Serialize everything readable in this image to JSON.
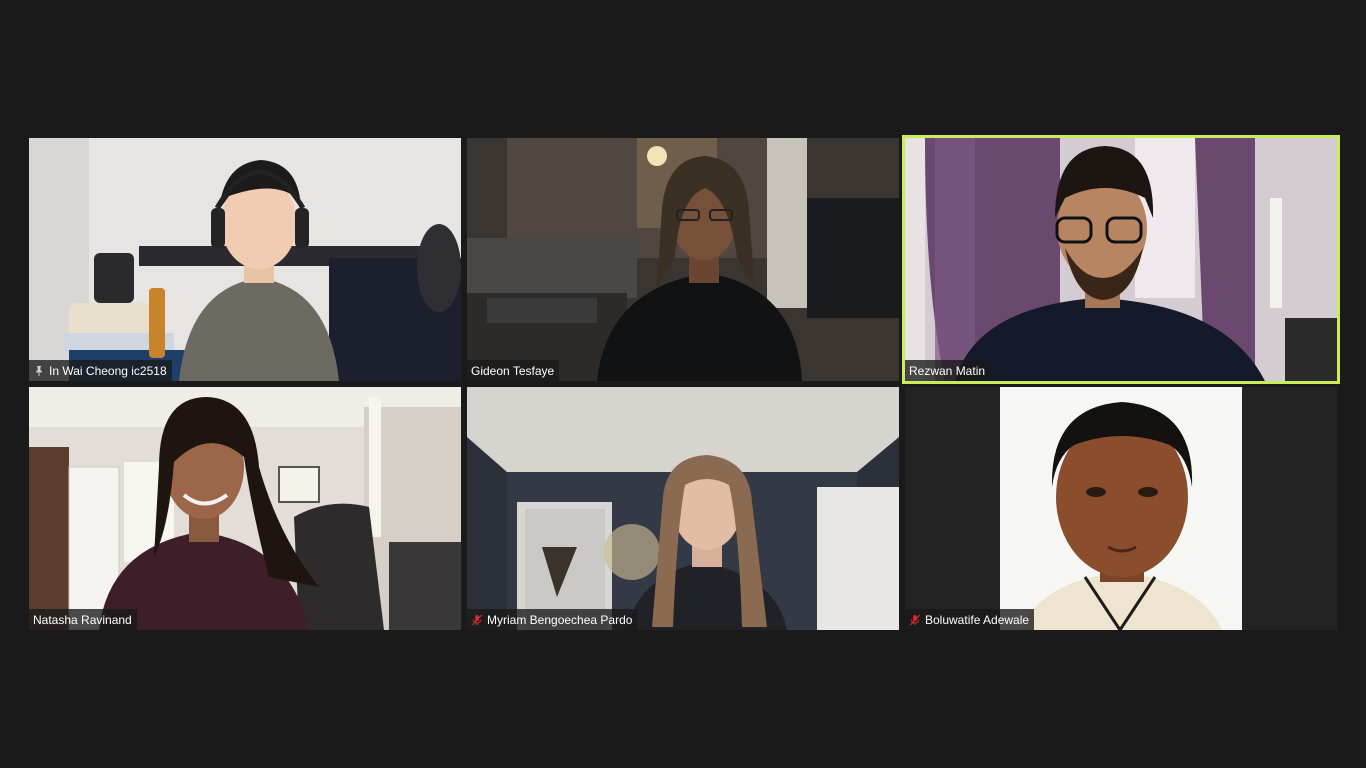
{
  "app": {
    "view": "gallery",
    "active_speaker_border_color": "#c9ec5a",
    "background_color": "#1a1a1a"
  },
  "participants": [
    {
      "name": "In Wai Cheong ic2518",
      "pinned": true,
      "muted": false,
      "active_speaker": false,
      "video": "on",
      "icon": "pin-icon"
    },
    {
      "name": "Gideon Tesfaye",
      "pinned": false,
      "muted": false,
      "active_speaker": false,
      "video": "on",
      "icon": ""
    },
    {
      "name": "Rezwan Matin",
      "pinned": false,
      "muted": false,
      "active_speaker": true,
      "video": "on",
      "icon": ""
    },
    {
      "name": "Natasha Ravinand",
      "pinned": false,
      "muted": false,
      "active_speaker": false,
      "video": "on",
      "icon": ""
    },
    {
      "name": "Myriam Bengoechea Pardo",
      "pinned": false,
      "muted": true,
      "active_speaker": false,
      "video": "on",
      "icon": "mic-muted-icon"
    },
    {
      "name": "Boluwatife Adewale",
      "pinned": false,
      "muted": true,
      "active_speaker": false,
      "video": "photo",
      "icon": "mic-muted-icon"
    }
  ],
  "colors": {
    "muted_icon": "#e02828",
    "nametag_text": "#ffffff"
  }
}
